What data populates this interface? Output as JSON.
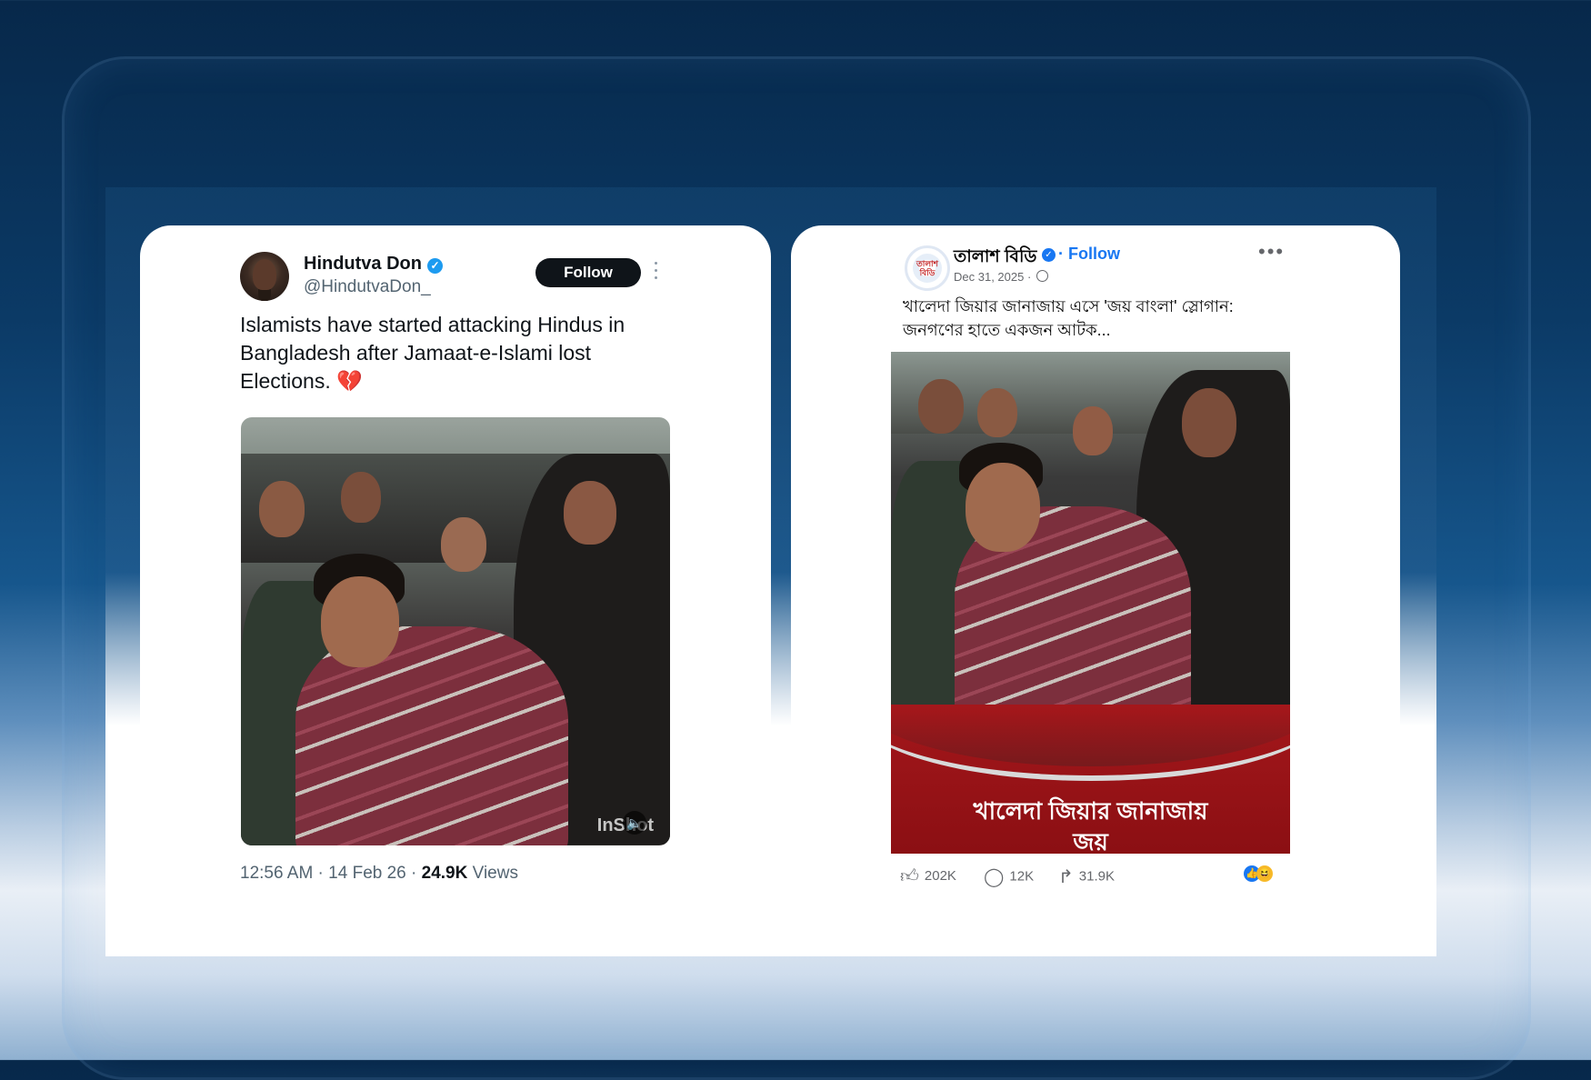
{
  "tweet": {
    "display_name": "Hindutva Don",
    "handle": "@HindutvaDon_",
    "follow_label": "Follow",
    "text": "Islamists have started attacking Hindus in Bangladesh after Jamaat-e-Islami lost Elections.",
    "emoji": "💔",
    "media_watermark": "InShot",
    "time": "12:56 AM",
    "date": "14 Feb 26",
    "views_count": "24.9K",
    "views_label": "Views",
    "icons": {
      "verified": "verified-badge-icon",
      "more": "more-options-icon",
      "sound": "speaker-icon"
    }
  },
  "fb_post": {
    "page_name": "তালাশ বিডি",
    "follow_label": "Follow",
    "date": "Dec 31, 2025",
    "caption": "খালেদা জিয়ার জানাজায় এসে 'জয় বাংলা' স্লোগান: জনগণের হাতে একজন আটক...",
    "avatar_text": "তালাশ বিডি",
    "banner_line1": "খালেদা জিয়ার জানাজায়",
    "banner_line2": "জয়",
    "likes": "202K",
    "comments": "12K",
    "shares": "31.9K",
    "icons": {
      "like": "thumbs-up-icon",
      "comment": "comment-icon",
      "share": "share-icon",
      "globe": "globe-icon",
      "more": "more-options-icon",
      "reactions": [
        "like-reaction-icon",
        "haha-reaction-icon"
      ]
    }
  },
  "colors": {
    "twitter_blue": "#1d9bf0",
    "facebook_blue": "#1877f2",
    "banner_red": "#a4171b"
  }
}
